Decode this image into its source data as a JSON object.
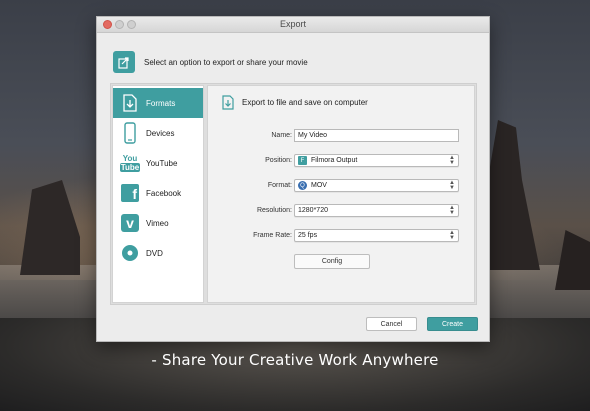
{
  "window": {
    "title": "Export"
  },
  "header": {
    "text": "Select an option to export or share your movie",
    "icon": "export-share-icon"
  },
  "sidebar": {
    "items": [
      {
        "label": "Formats",
        "icon": "document-download-icon",
        "active": true
      },
      {
        "label": "Devices",
        "icon": "phone-icon"
      },
      {
        "label": "YouTube",
        "icon": "youtube-icon",
        "icon_text_top": "You",
        "icon_text_bottom": "Tube"
      },
      {
        "label": "Facebook",
        "icon": "facebook-icon",
        "icon_text": "f"
      },
      {
        "label": "Vimeo",
        "icon": "vimeo-icon",
        "icon_text": "v"
      },
      {
        "label": "DVD",
        "icon": "disc-icon"
      }
    ]
  },
  "content": {
    "heading": "Export to file and save on computer",
    "fields": {
      "name": {
        "label": "Name:",
        "value": "My Video"
      },
      "position": {
        "label": "Position:",
        "value": "Filmora Output"
      },
      "format": {
        "label": "Format:",
        "value": "MOV"
      },
      "resolution": {
        "label": "Resolution:",
        "value": "1280*720"
      },
      "frame_rate": {
        "label": "Frame Rate:",
        "value": "25 fps"
      }
    },
    "config_label": "Config"
  },
  "footer": {
    "cancel_label": "Cancel",
    "create_label": "Create"
  },
  "caption": "- Share Your Creative Work Anywhere",
  "colors": {
    "accent": "#3f9ea0"
  }
}
